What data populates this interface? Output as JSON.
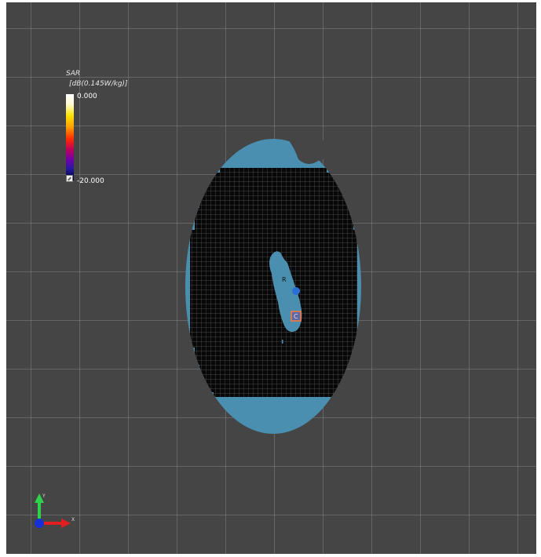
{
  "legend": {
    "title": "SAR",
    "unit": "[dB(0.145W/kg)]",
    "max_value": "0.000",
    "min_value": "-20.000"
  },
  "markers": {
    "probe_label": "R",
    "cursor_label": "C"
  },
  "axes": {
    "y_label": "Y",
    "x_label": "X"
  },
  "colors": {
    "background": "#454545",
    "phantom": "#4a8fb0",
    "measurement_area": "#080808"
  }
}
